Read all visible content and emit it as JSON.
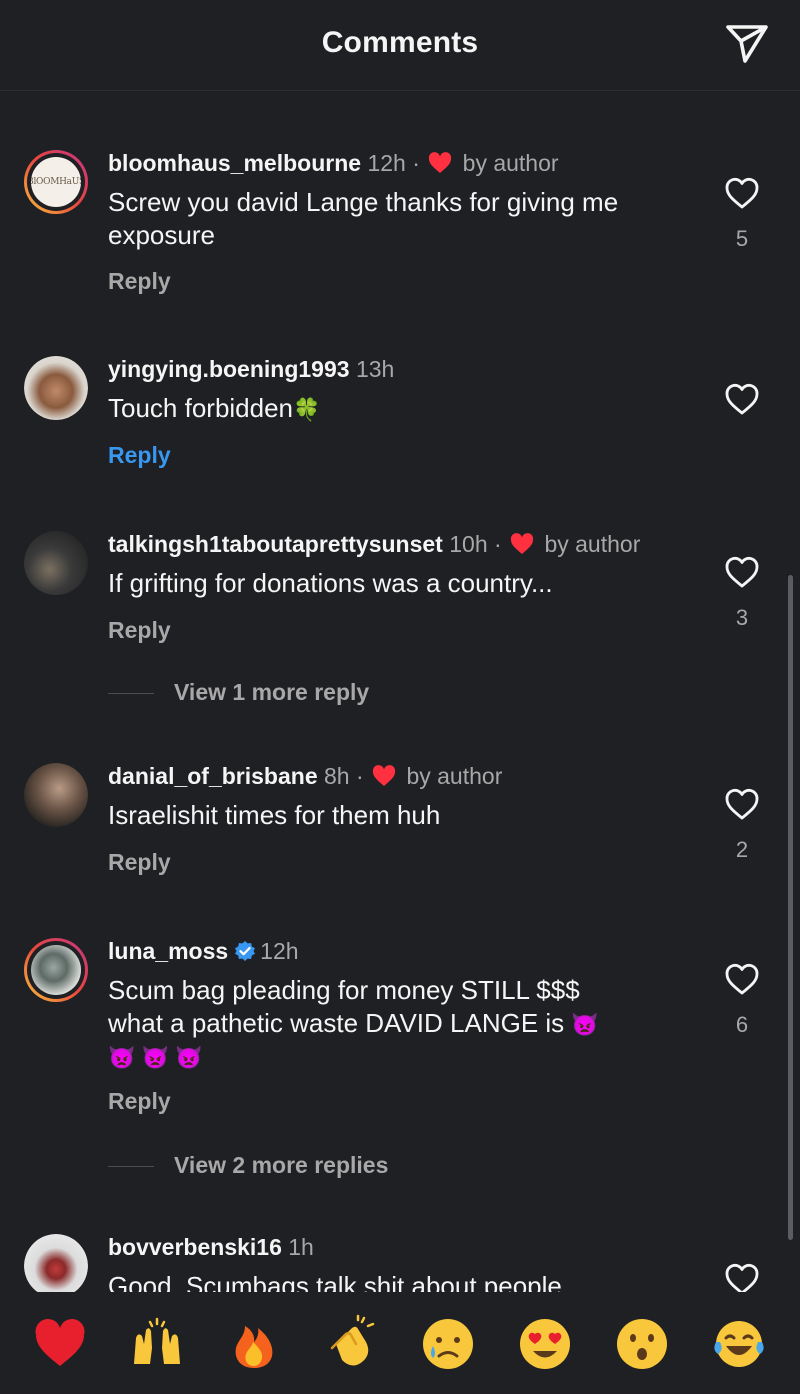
{
  "header": {
    "title": "Comments",
    "send_icon": "paper-plane-icon"
  },
  "comments": [
    {
      "username": "bloomhaus_melbourne",
      "time": "12h",
      "liked_by_author": true,
      "author_label": "by author",
      "text": "Screw you david Lange thanks for giving me exposure",
      "reply_label": "Reply",
      "likes": "5",
      "avatar_text": "BlOOMHaUS"
    },
    {
      "username": "yingying.boening1993",
      "time": "13h",
      "text": "Touch forbidden",
      "text_emoji": "🍀",
      "reply_label": "Reply"
    },
    {
      "username": "talkingsh1taboutaprettysunset",
      "time": "10h",
      "liked_by_author": true,
      "author_label": "by author",
      "text": "If grifting for donations was a country...",
      "reply_label": "Reply",
      "likes": "3",
      "view_more": "View 1 more reply"
    },
    {
      "username": "danial_of_brisbane",
      "time": "8h",
      "liked_by_author": true,
      "author_label": "by author",
      "text": "Israelishit times for them huh",
      "reply_label": "Reply",
      "likes": "2"
    },
    {
      "username": "luna_moss",
      "verified": true,
      "time": "12h",
      "text_line1": "Scum bag pleading for money STILL $$$",
      "text_line2": "what a pathetic waste DAVID LANGE  is",
      "text_emoji_end": "👿",
      "text_emoji_line3": "👿 👿 👿",
      "reply_label": "Reply",
      "likes": "6",
      "view_more": "View 2 more replies"
    },
    {
      "username": "bovverbenski16",
      "time": "1h",
      "text": "Good. Scumbags talk shit about people"
    }
  ],
  "reactions": [
    "❤️",
    "🙌",
    "🔥",
    "👏",
    "😢",
    "😍",
    "😮",
    "😂"
  ],
  "colors": {
    "background": "#1f2024",
    "accent": "#3897f0",
    "heart": "#ff3040",
    "muted": "#a8a8a8"
  }
}
